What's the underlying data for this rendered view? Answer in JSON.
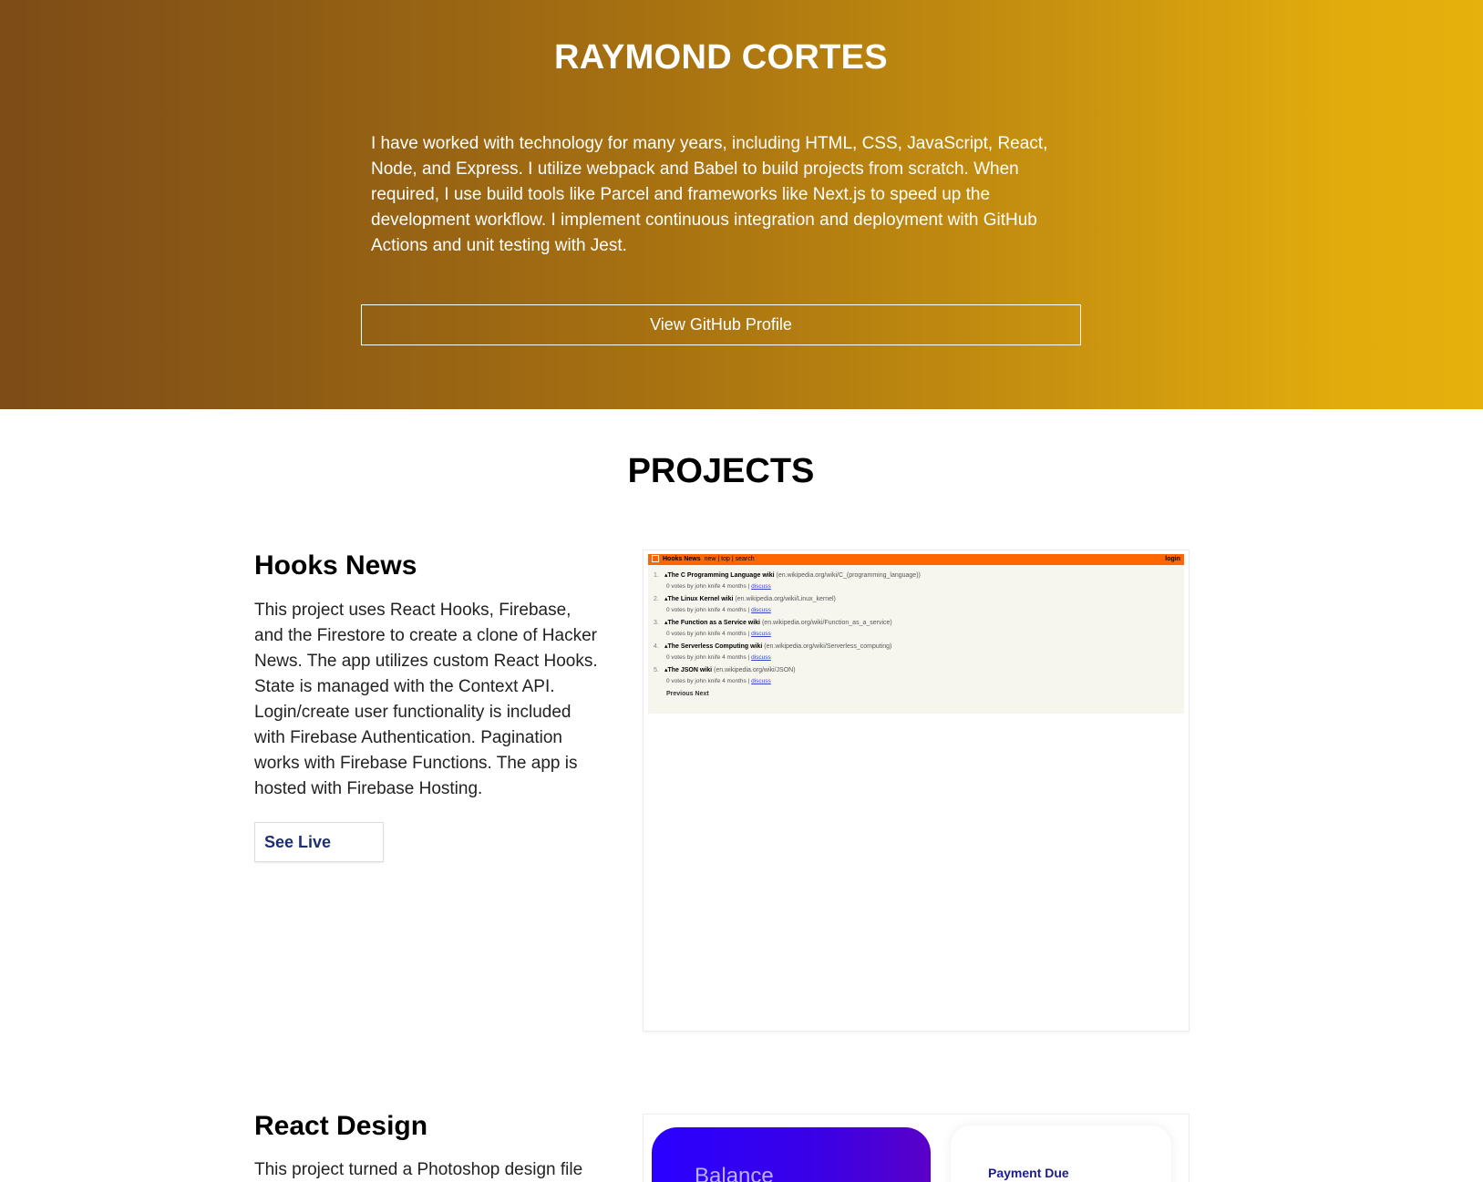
{
  "hero": {
    "name": "RAYMOND CORTES",
    "bio": "I have worked with technology for many years, including HTML, CSS, JavaScript, React, Node, and Express. I utilize webpack and Babel to build projects from scratch. When required, I use build tools like Parcel and frameworks like Next.js to speed up the development workflow. I implement continuous integration and deployment with GitHub Actions and unit testing with Jest.",
    "button_label": "View GitHub Profile"
  },
  "projects": {
    "heading": "PROJECTS",
    "items": [
      {
        "title": "Hooks News",
        "description": "This project uses React Hooks, Firebase, and the Firestore to create a clone of Hacker News. The app utilizes custom React Hooks. State is managed with the Context API. Login/create user functionality is included with Firebase Authentication. Pagination works with Firebase Functions. The app is hosted with Firebase Hosting.",
        "button_label": "See Live"
      },
      {
        "title": "React Design",
        "description": "This project turned a Photoshop design file"
      }
    ]
  },
  "hooks_news_preview": {
    "brand": "Hooks News",
    "nav": "new | top | search",
    "login": "login",
    "stories": [
      {
        "num": "1.",
        "title": "The C Programming Language wiki",
        "domain": "(en.wikipedia.org/wiki/C_(programming_language))",
        "meta": "0 votes by john knife 4 months |",
        "discuss": "discuss"
      },
      {
        "num": "2.",
        "title": "The Linux Kernel wiki",
        "domain": "(en.wikipedia.org/wiki/Linux_kernel)",
        "meta": "0 votes by john knife 4 months |",
        "discuss": "discuss"
      },
      {
        "num": "3.",
        "title": "The Function as a Service wiki",
        "domain": "(en.wikipedia.org/wiki/Function_as_a_service)",
        "meta": "0 votes by john knife 4 months |",
        "discuss": "discuss"
      },
      {
        "num": "4.",
        "title": "The Serverless Computing wiki",
        "domain": "(en.wikipedia.org/wiki/Serverless_computing)",
        "meta": "0 votes by john knife 4 months |",
        "discuss": "discuss"
      },
      {
        "num": "5.",
        "title": "The JSON wiki",
        "domain": "(en.wikipedia.org/wiki/JSON)",
        "meta": "0 votes by john knife 4 months |",
        "discuss": "discuss"
      }
    ],
    "pagination": "Previous Next"
  },
  "react_design_preview": {
    "balance_label": "Balance",
    "payment_label": "Payment Due"
  }
}
